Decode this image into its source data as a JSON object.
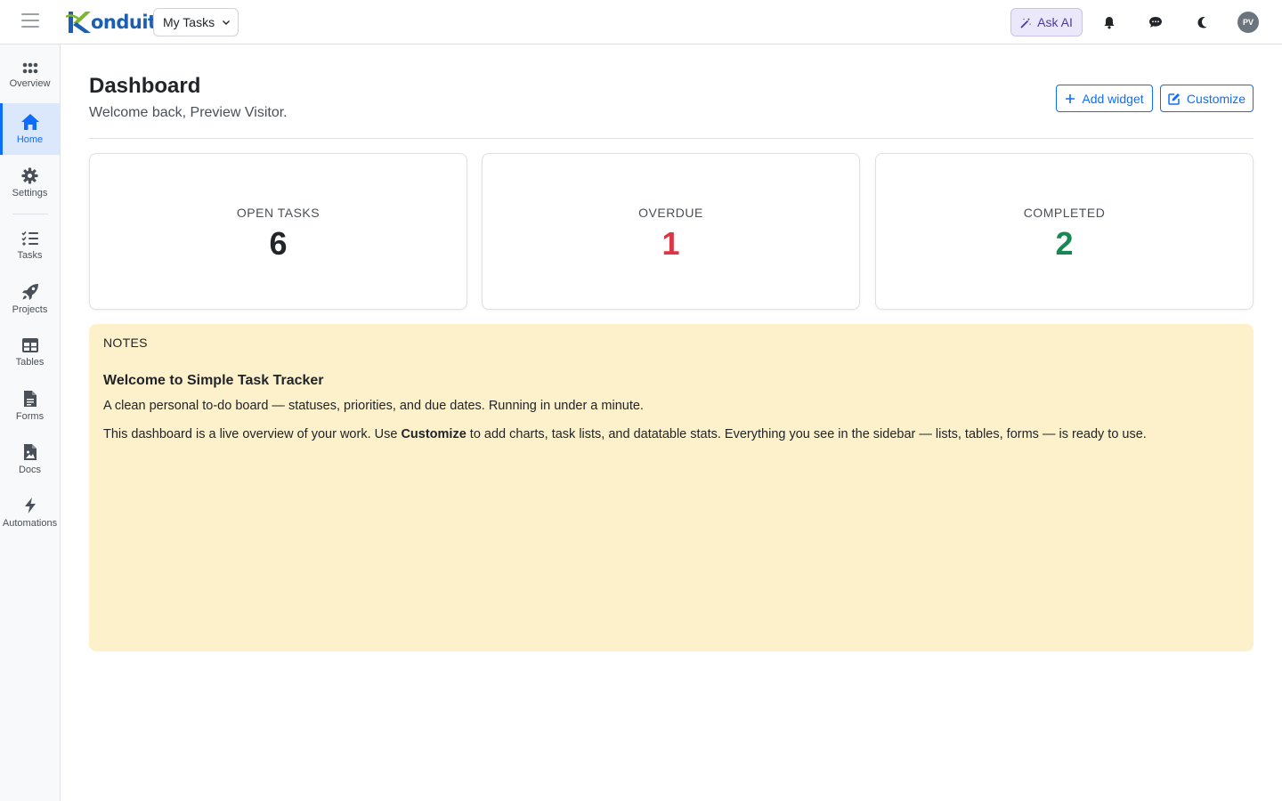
{
  "header": {
    "logo_text": "onduit",
    "workspace_label": "My Tasks",
    "ask_ai_label": "Ask AI",
    "avatar_initials": "PV"
  },
  "sidebar": {
    "items": [
      {
        "label": "Overview",
        "icon": "grid-icon"
      },
      {
        "label": "Home",
        "icon": "home-icon",
        "active": true
      },
      {
        "label": "Settings",
        "icon": "gear-icon"
      },
      {
        "label": "Tasks",
        "icon": "tasks-list-icon"
      },
      {
        "label": "Projects",
        "icon": "rocket-icon"
      },
      {
        "label": "Tables",
        "icon": "table-icon"
      },
      {
        "label": "Forms",
        "icon": "form-document-icon"
      },
      {
        "label": "Docs",
        "icon": "docs-image-icon"
      },
      {
        "label": "Automations",
        "icon": "lightning-icon"
      }
    ]
  },
  "main": {
    "title": "Dashboard",
    "subtitle": "Welcome back, Preview Visitor.",
    "add_widget_label": "Add widget",
    "customize_label": "Customize",
    "stats": [
      {
        "label": "OPEN TASKS",
        "value": "6",
        "color": "#212529"
      },
      {
        "label": "OVERDUE",
        "value": "1",
        "color": "#dc3545"
      },
      {
        "label": "COMPLETED",
        "value": "2",
        "color": "#198754"
      }
    ],
    "notes": {
      "label": "NOTES",
      "heading": "Welcome to Simple Task Tracker",
      "paragraph1": "A clean personal to-do board — statuses, priorities, and due dates. Running in under a minute.",
      "paragraph2_before": "This dashboard is a live overview of your work. Use ",
      "paragraph2_bold": "Customize",
      "paragraph2_after": " to add charts, task lists, and datatable stats. Everything you see in the sidebar — lists, tables, forms — is ready to use."
    }
  },
  "colors": {
    "primary": "#0d6efd",
    "notes_bg": "#fdf1cc",
    "ai_bg": "#ece8fb"
  }
}
